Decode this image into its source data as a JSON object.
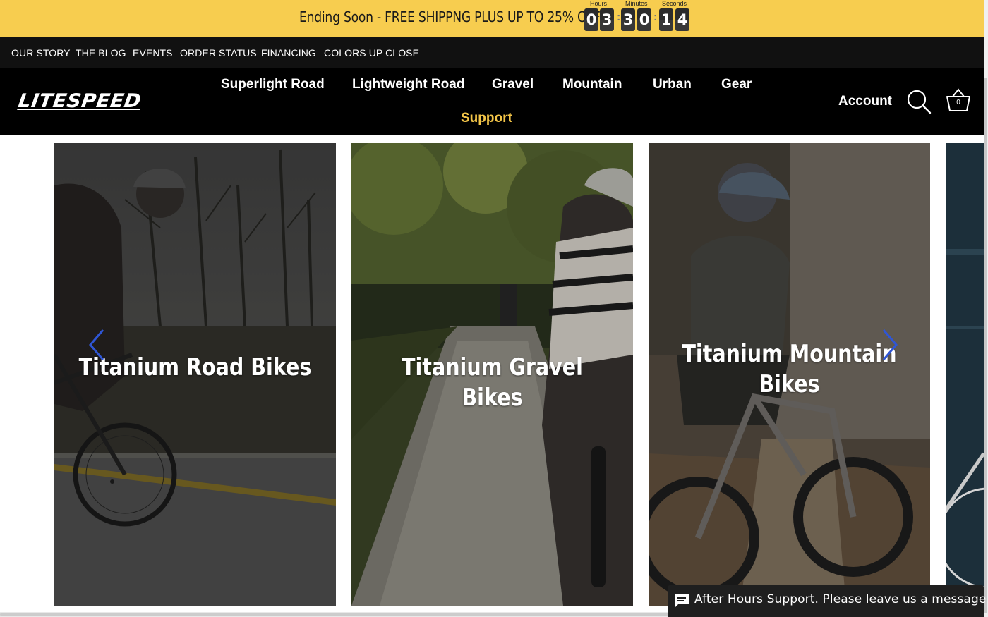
{
  "promo": {
    "text": "Ending Soon - FREE SHIPPNG PLUS UP TO 25% OFF",
    "countdown": {
      "hours_label": "Hours",
      "minutes_label": "Minutes",
      "seconds_label": "Seconds",
      "hours": [
        "0",
        "3"
      ],
      "minutes": [
        "3",
        "0"
      ],
      "seconds": [
        "1",
        "4"
      ]
    }
  },
  "utility_nav": [
    "OUR STORY",
    "THE BLOG",
    "EVENTS",
    "ORDER STATUS",
    "FINANCING",
    "COLORS UP CLOSE"
  ],
  "header": {
    "logo": "LITESPEED",
    "nav": [
      "Superlight Road",
      "Lightweight Road",
      "Gravel",
      "Mountain",
      "Urban",
      "Gear",
      "Support"
    ],
    "account": "Account",
    "cart_count": "0"
  },
  "carousel": {
    "cards": [
      {
        "title": "Titanium Road Bikes"
      },
      {
        "title": "Titanium Gravel Bikes"
      },
      {
        "title_line1": "Titanium Mountain",
        "title_line2": "Bikes"
      }
    ]
  },
  "chat": {
    "text": "After Hours Support. Please leave us a message"
  },
  "colors": {
    "promo_bg": "#f7cd4f",
    "header_bg": "#000000",
    "utility_bg": "#111111",
    "support_accent": "#f3c548",
    "arrow_accent": "#2f56d6"
  }
}
